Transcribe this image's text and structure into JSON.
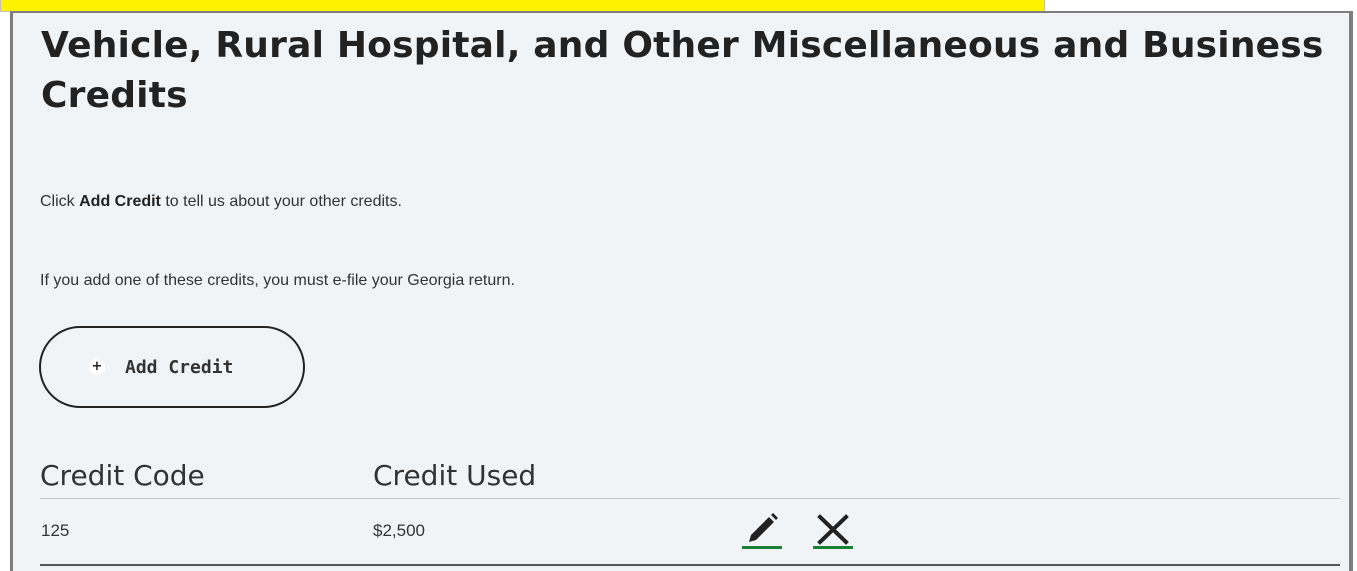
{
  "page": {
    "title": "Vehicle, Rural Hospital, and Other Miscellaneous and Business Credits",
    "instruction_prefix": "Click ",
    "instruction_strong": "Add Credit",
    "instruction_suffix": " to tell us about your other credits.",
    "efile_note": "If you add one of these credits, you must e-file your Georgia return."
  },
  "add_button": {
    "label": "Add Credit",
    "icon": "plus-circle-icon"
  },
  "table": {
    "columns": [
      "Credit Code",
      "Credit Used"
    ],
    "rows": [
      {
        "code": "125",
        "used": "$2,500",
        "actions": [
          "edit-icon",
          "delete-icon"
        ]
      }
    ]
  },
  "colors": {
    "panel_bg": "#f0f4f7",
    "highlight": "#fff200",
    "action_underline": "#1a7f37",
    "text": "#222222"
  }
}
